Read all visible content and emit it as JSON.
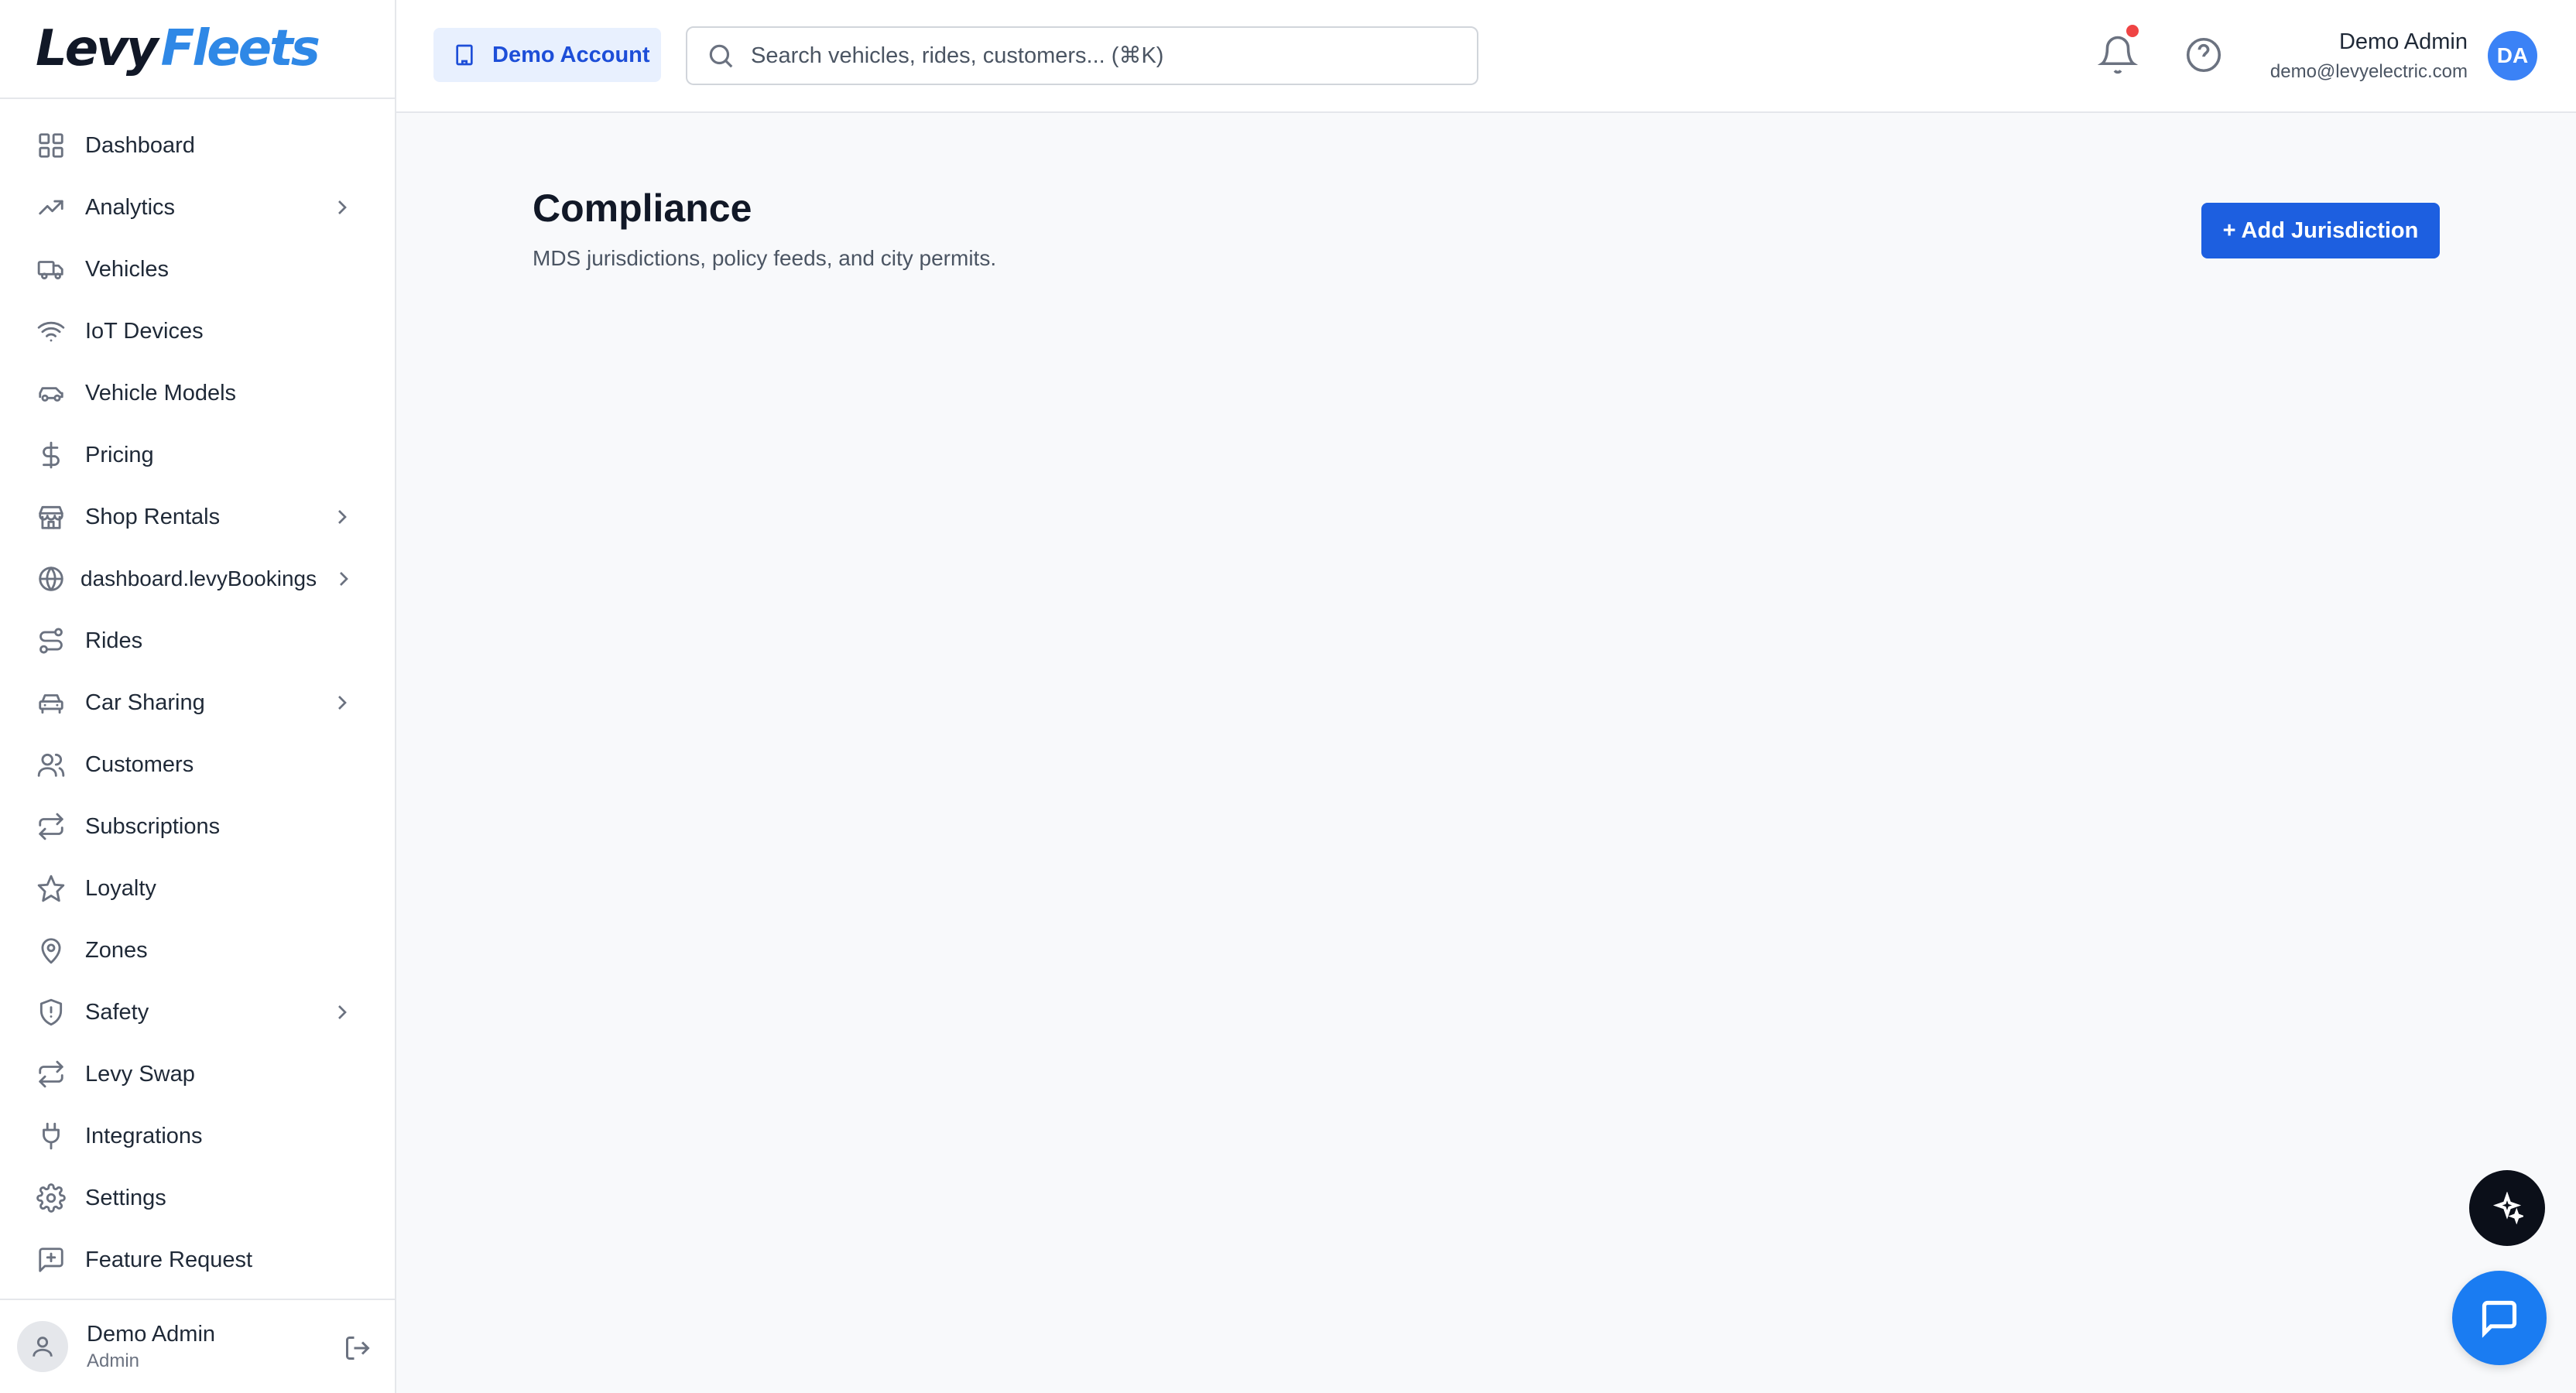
{
  "brand": {
    "logo_part1": "Levy",
    "logo_part2": "Fleets",
    "accent": "#2f88e6"
  },
  "sidebar": {
    "items": [
      {
        "label": "Dashboard",
        "icon": "grid-icon",
        "has_chevron": false
      },
      {
        "label": "Analytics",
        "icon": "trending-up-icon",
        "has_chevron": true
      },
      {
        "label": "Vehicles",
        "icon": "truck-icon",
        "has_chevron": false
      },
      {
        "label": "IoT Devices",
        "icon": "wifi-icon",
        "has_chevron": false
      },
      {
        "label": "Vehicle Models",
        "icon": "car-icon",
        "has_chevron": false
      },
      {
        "label": "Pricing",
        "icon": "dollar-icon",
        "has_chevron": false
      },
      {
        "label": "Shop Rentals",
        "icon": "store-icon",
        "has_chevron": true
      },
      {
        "label": "dashboard.levyBookings",
        "icon": "globe-icon",
        "has_chevron": true
      },
      {
        "label": "Rides",
        "icon": "route-icon",
        "has_chevron": false
      },
      {
        "label": "Car Sharing",
        "icon": "car-front-icon",
        "has_chevron": true
      },
      {
        "label": "Customers",
        "icon": "users-icon",
        "has_chevron": false
      },
      {
        "label": "Subscriptions",
        "icon": "repeat-icon",
        "has_chevron": false
      },
      {
        "label": "Loyalty",
        "icon": "star-icon",
        "has_chevron": false
      },
      {
        "label": "Zones",
        "icon": "map-pin-icon",
        "has_chevron": false
      },
      {
        "label": "Safety",
        "icon": "shield-icon",
        "has_chevron": true
      },
      {
        "label": "Levy Swap",
        "icon": "swap-icon",
        "has_chevron": false
      },
      {
        "label": "Integrations",
        "icon": "plug-icon",
        "has_chevron": false
      },
      {
        "label": "Settings",
        "icon": "gear-icon",
        "has_chevron": false
      },
      {
        "label": "Feature Request",
        "icon": "message-plus-icon",
        "has_chevron": false
      }
    ],
    "footer": {
      "name": "Demo Admin",
      "role": "Admin"
    }
  },
  "header": {
    "account_label": "Demo Account",
    "search_placeholder": "Search vehicles, rides, customers... (⌘K)",
    "user_name": "Demo Admin",
    "user_email": "demo@levyelectric.com",
    "avatar_initials": "DA"
  },
  "main": {
    "title": "Compliance",
    "subtitle": "MDS jurisdictions, policy feeds, and city permits.",
    "add_button": "+ Add Jurisdiction"
  }
}
